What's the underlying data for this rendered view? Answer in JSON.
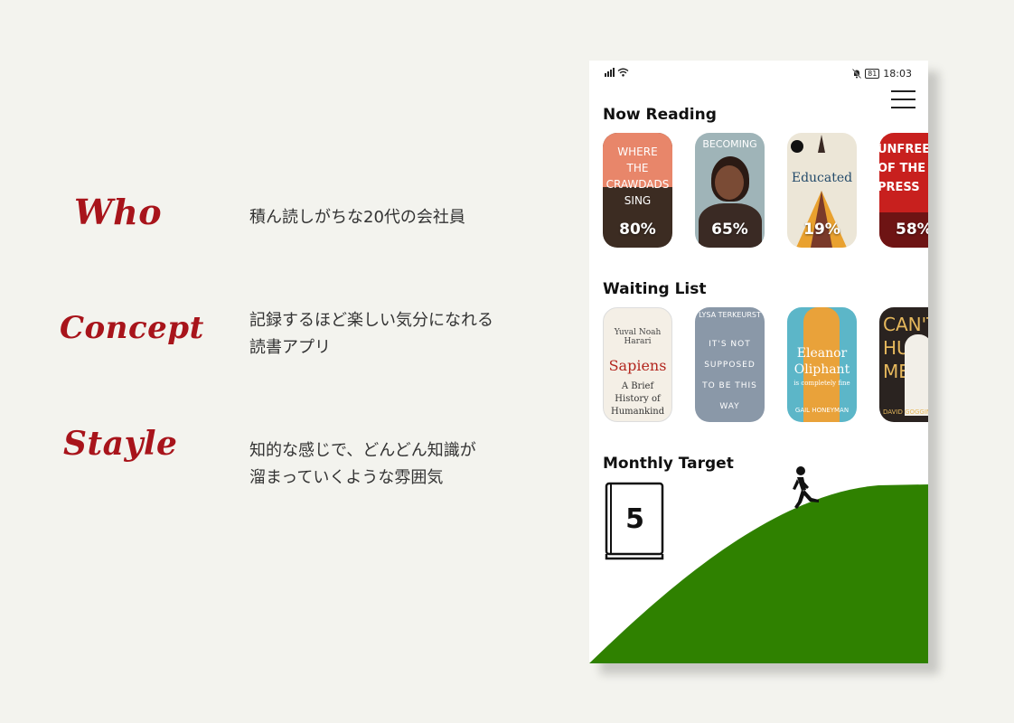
{
  "persona": [
    {
      "label": "Who",
      "text": "積ん読しがちな20代の会社員"
    },
    {
      "label": "Concept",
      "text": "記録するほど楽しい気分になれる\n読書アプリ"
    },
    {
      "label": "Stayle",
      "text": "知的な感じで、どんどん知識が\n溜まっていくような雰囲気"
    }
  ],
  "status_bar": {
    "time": "18:03",
    "battery": "81"
  },
  "now_reading": {
    "title": "Now Reading",
    "books": [
      {
        "cover_text": "WHERE THE CRAWDADS SING",
        "progress": "80%",
        "color": "#e8866a"
      },
      {
        "cover_text": "BECOMING",
        "progress": "65%",
        "color": "#9fb4b8"
      },
      {
        "cover_text": "Educated",
        "progress": "19%",
        "color": "#ece6d7"
      },
      {
        "cover_text": "UNFREEDOM OF THE PRESS",
        "progress": "58%",
        "color": "#c8201e"
      }
    ]
  },
  "waiting_list": {
    "title": "Waiting List",
    "books": [
      {
        "cover_text": "Sapiens",
        "sub_text": "A Brief History of Humankind",
        "author": "Yuval Noah Harari",
        "color": "#f4efe6"
      },
      {
        "cover_text": "IT'S NOT SUPPOSED TO BE THIS WAY",
        "author": "LYSA TERKEURST",
        "color": "#8a98a8"
      },
      {
        "cover_text": "Eleanor Oliphant",
        "sub_text": "is completely fine",
        "author": "GAIL HONEYMAN",
        "color": "#e9a23a"
      },
      {
        "cover_text": "CAN'T HURT ME",
        "author": "DAVID GOGGINS",
        "color": "#2a2320"
      }
    ]
  },
  "monthly_target": {
    "title": "Monthly Target",
    "count": "5",
    "hill_color": "#2f8100"
  }
}
